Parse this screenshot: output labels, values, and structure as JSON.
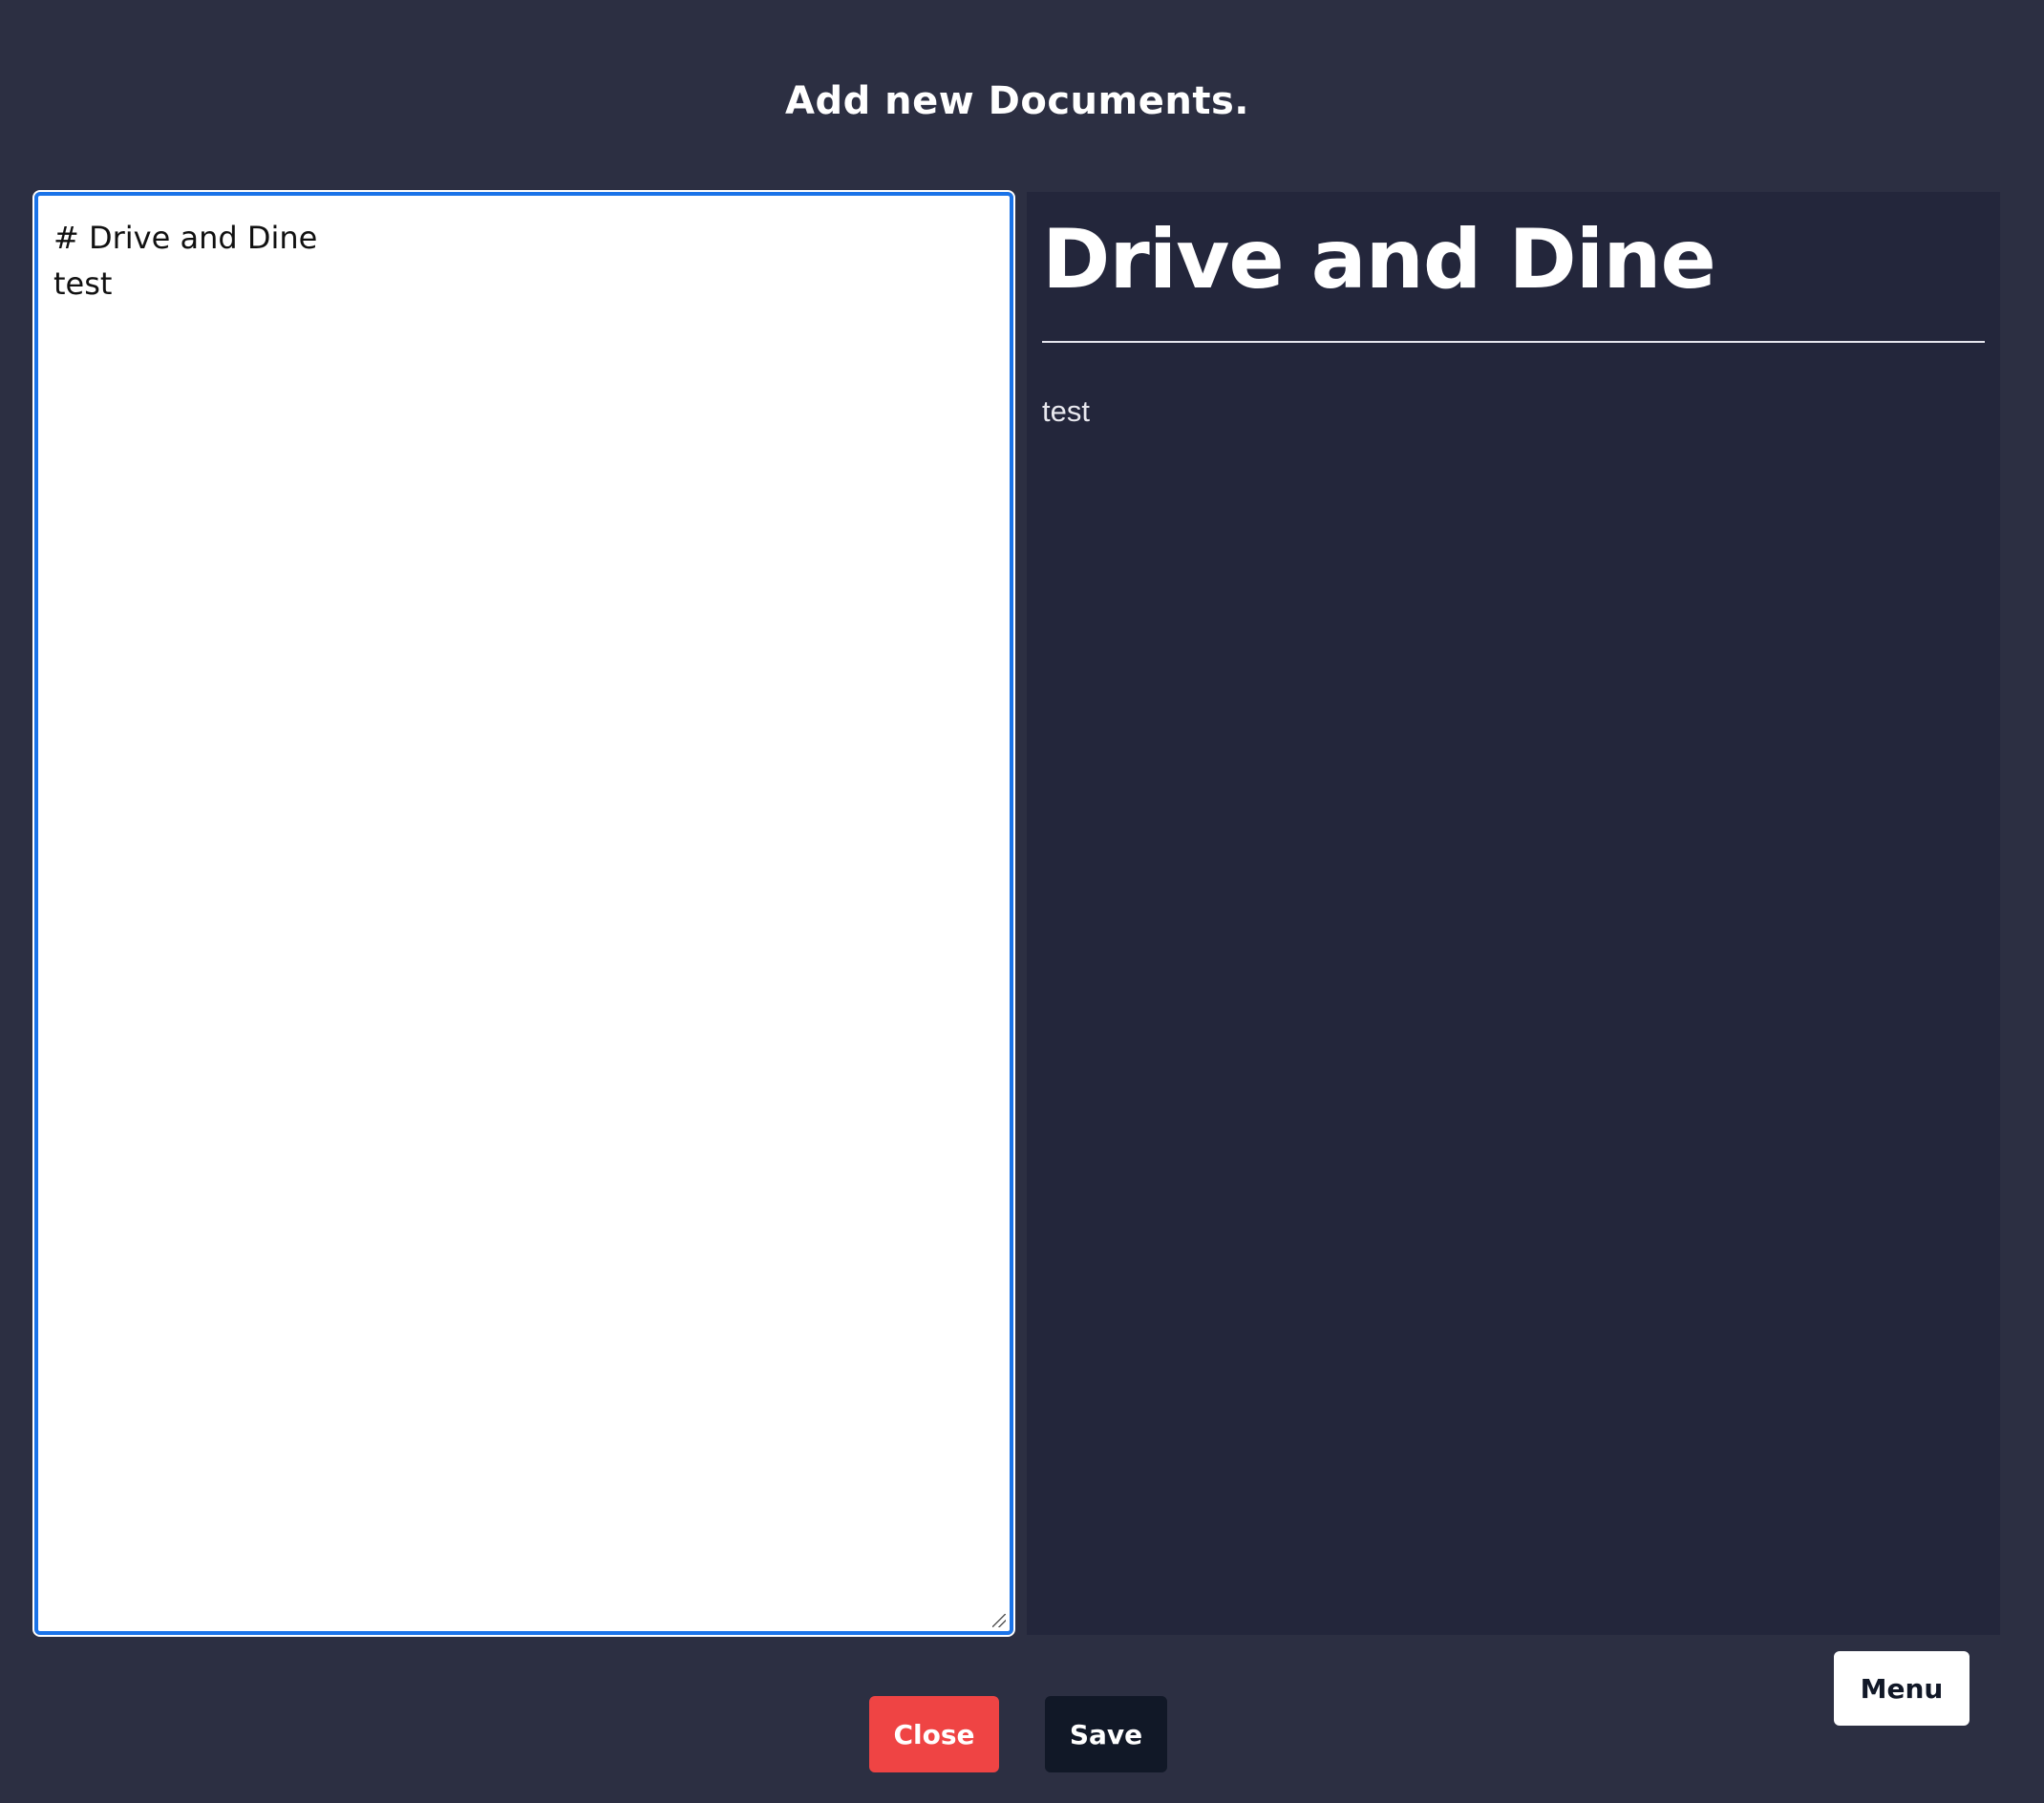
{
  "page": {
    "title": "Add new Documents."
  },
  "editor": {
    "content": "# Drive and Dine\ntest"
  },
  "preview": {
    "heading": "Drive and Dine",
    "body": "test"
  },
  "buttons": {
    "close_label": "Close",
    "save_label": "Save",
    "menu_label": "Menu"
  },
  "colors": {
    "background": "#2c2f42",
    "preview_background": "#23263b",
    "editor_focus_border": "#1a73e8",
    "close_button": "#ef4444",
    "save_button": "#111827",
    "menu_button": "#ffffff"
  }
}
